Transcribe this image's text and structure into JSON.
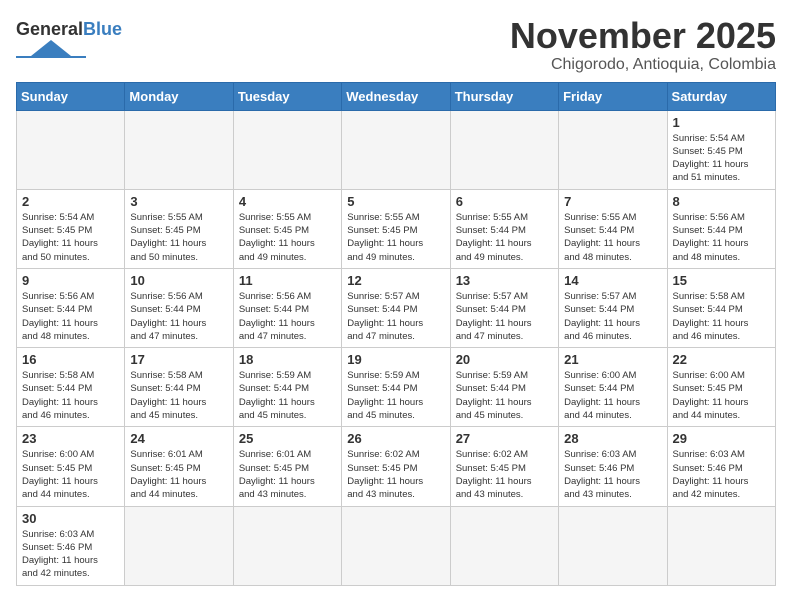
{
  "header": {
    "logo_general": "General",
    "logo_blue": "Blue",
    "month_title": "November 2025",
    "location": "Chigorodo, Antioquia, Colombia"
  },
  "weekdays": [
    "Sunday",
    "Monday",
    "Tuesday",
    "Wednesday",
    "Thursday",
    "Friday",
    "Saturday"
  ],
  "weeks": [
    [
      {
        "day": "",
        "info": ""
      },
      {
        "day": "",
        "info": ""
      },
      {
        "day": "",
        "info": ""
      },
      {
        "day": "",
        "info": ""
      },
      {
        "day": "",
        "info": ""
      },
      {
        "day": "",
        "info": ""
      },
      {
        "day": "1",
        "info": "Sunrise: 5:54 AM\nSunset: 5:45 PM\nDaylight: 11 hours\nand 51 minutes."
      }
    ],
    [
      {
        "day": "2",
        "info": "Sunrise: 5:54 AM\nSunset: 5:45 PM\nDaylight: 11 hours\nand 50 minutes."
      },
      {
        "day": "3",
        "info": "Sunrise: 5:55 AM\nSunset: 5:45 PM\nDaylight: 11 hours\nand 50 minutes."
      },
      {
        "day": "4",
        "info": "Sunrise: 5:55 AM\nSunset: 5:45 PM\nDaylight: 11 hours\nand 49 minutes."
      },
      {
        "day": "5",
        "info": "Sunrise: 5:55 AM\nSunset: 5:45 PM\nDaylight: 11 hours\nand 49 minutes."
      },
      {
        "day": "6",
        "info": "Sunrise: 5:55 AM\nSunset: 5:44 PM\nDaylight: 11 hours\nand 49 minutes."
      },
      {
        "day": "7",
        "info": "Sunrise: 5:55 AM\nSunset: 5:44 PM\nDaylight: 11 hours\nand 48 minutes."
      },
      {
        "day": "8",
        "info": "Sunrise: 5:56 AM\nSunset: 5:44 PM\nDaylight: 11 hours\nand 48 minutes."
      }
    ],
    [
      {
        "day": "9",
        "info": "Sunrise: 5:56 AM\nSunset: 5:44 PM\nDaylight: 11 hours\nand 48 minutes."
      },
      {
        "day": "10",
        "info": "Sunrise: 5:56 AM\nSunset: 5:44 PM\nDaylight: 11 hours\nand 47 minutes."
      },
      {
        "day": "11",
        "info": "Sunrise: 5:56 AM\nSunset: 5:44 PM\nDaylight: 11 hours\nand 47 minutes."
      },
      {
        "day": "12",
        "info": "Sunrise: 5:57 AM\nSunset: 5:44 PM\nDaylight: 11 hours\nand 47 minutes."
      },
      {
        "day": "13",
        "info": "Sunrise: 5:57 AM\nSunset: 5:44 PM\nDaylight: 11 hours\nand 47 minutes."
      },
      {
        "day": "14",
        "info": "Sunrise: 5:57 AM\nSunset: 5:44 PM\nDaylight: 11 hours\nand 46 minutes."
      },
      {
        "day": "15",
        "info": "Sunrise: 5:58 AM\nSunset: 5:44 PM\nDaylight: 11 hours\nand 46 minutes."
      }
    ],
    [
      {
        "day": "16",
        "info": "Sunrise: 5:58 AM\nSunset: 5:44 PM\nDaylight: 11 hours\nand 46 minutes."
      },
      {
        "day": "17",
        "info": "Sunrise: 5:58 AM\nSunset: 5:44 PM\nDaylight: 11 hours\nand 45 minutes."
      },
      {
        "day": "18",
        "info": "Sunrise: 5:59 AM\nSunset: 5:44 PM\nDaylight: 11 hours\nand 45 minutes."
      },
      {
        "day": "19",
        "info": "Sunrise: 5:59 AM\nSunset: 5:44 PM\nDaylight: 11 hours\nand 45 minutes."
      },
      {
        "day": "20",
        "info": "Sunrise: 5:59 AM\nSunset: 5:44 PM\nDaylight: 11 hours\nand 45 minutes."
      },
      {
        "day": "21",
        "info": "Sunrise: 6:00 AM\nSunset: 5:44 PM\nDaylight: 11 hours\nand 44 minutes."
      },
      {
        "day": "22",
        "info": "Sunrise: 6:00 AM\nSunset: 5:45 PM\nDaylight: 11 hours\nand 44 minutes."
      }
    ],
    [
      {
        "day": "23",
        "info": "Sunrise: 6:00 AM\nSunset: 5:45 PM\nDaylight: 11 hours\nand 44 minutes."
      },
      {
        "day": "24",
        "info": "Sunrise: 6:01 AM\nSunset: 5:45 PM\nDaylight: 11 hours\nand 44 minutes."
      },
      {
        "day": "25",
        "info": "Sunrise: 6:01 AM\nSunset: 5:45 PM\nDaylight: 11 hours\nand 43 minutes."
      },
      {
        "day": "26",
        "info": "Sunrise: 6:02 AM\nSunset: 5:45 PM\nDaylight: 11 hours\nand 43 minutes."
      },
      {
        "day": "27",
        "info": "Sunrise: 6:02 AM\nSunset: 5:45 PM\nDaylight: 11 hours\nand 43 minutes."
      },
      {
        "day": "28",
        "info": "Sunrise: 6:03 AM\nSunset: 5:46 PM\nDaylight: 11 hours\nand 43 minutes."
      },
      {
        "day": "29",
        "info": "Sunrise: 6:03 AM\nSunset: 5:46 PM\nDaylight: 11 hours\nand 42 minutes."
      }
    ],
    [
      {
        "day": "30",
        "info": "Sunrise: 6:03 AM\nSunset: 5:46 PM\nDaylight: 11 hours\nand 42 minutes."
      },
      {
        "day": "",
        "info": ""
      },
      {
        "day": "",
        "info": ""
      },
      {
        "day": "",
        "info": ""
      },
      {
        "day": "",
        "info": ""
      },
      {
        "day": "",
        "info": ""
      },
      {
        "day": "",
        "info": ""
      }
    ]
  ]
}
